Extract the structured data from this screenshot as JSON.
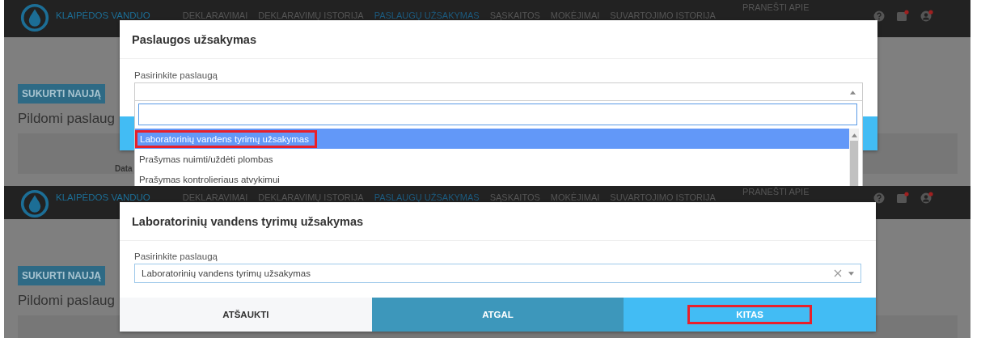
{
  "screens": [
    {
      "header": {
        "logo_text": "KLAIPĖDOS VANDUO",
        "nav": [
          {
            "label": "DEKLARAVIMAI",
            "selected": false
          },
          {
            "label": "DEKLARAVIMŲ ISTORIJA",
            "selected": false
          },
          {
            "label": "PASLAUGŲ UŽSAKYMAS",
            "selected": true
          },
          {
            "label": "SĄSKAITOS",
            "selected": false
          },
          {
            "label": "MOKĖJIMAI",
            "selected": false
          },
          {
            "label": "SUVARTOJIMO ISTORIJA",
            "selected": false
          },
          {
            "label": "PRANEŠTI APIE",
            "selected": false
          }
        ]
      },
      "page": {
        "create_button": "SUKURTI NAUJĄ",
        "heading": "Pildomi paslaug",
        "table_header": "Data"
      },
      "dialog": {
        "title": "Paslaugos užsakymas",
        "field_label": "Pasirinkite paslaugą",
        "expanded": true,
        "options": [
          {
            "label": "Laboratorinių vandens tyrimų užsakymas",
            "selected": true,
            "annotated": true
          },
          {
            "label": "Prašymas nuimti/uždėti plombas",
            "selected": false,
            "annotated": false
          },
          {
            "label": "Prašymas kontrolieriaus atvykimui",
            "selected": false,
            "annotated": false
          }
        ]
      }
    },
    {
      "header": {
        "logo_text": "KLAIPĖDOS VANDUO",
        "nav": [
          {
            "label": "DEKLARAVIMAI",
            "selected": false
          },
          {
            "label": "DEKLARAVIMŲ ISTORIJA",
            "selected": false
          },
          {
            "label": "PASLAUGŲ UŽSAKYMAS",
            "selected": true
          },
          {
            "label": "SĄSKAITOS",
            "selected": false
          },
          {
            "label": "MOKĖJIMAI",
            "selected": false
          },
          {
            "label": "SUVARTOJIMO ISTORIJA",
            "selected": false
          },
          {
            "label": "PRANEŠTI APIE",
            "selected": false
          }
        ]
      },
      "page": {
        "create_button": "SUKURTI NAUJĄ",
        "heading": "Pildomi paslaug"
      },
      "dialog": {
        "title": "Laboratorinių vandens tyrimų užsakymas",
        "field_label": "Pasirinkite paslaugą",
        "value": "Laboratorinių vandens tyrimų užsakymas",
        "expanded": false,
        "buttons": [
          {
            "label": "ATŠAUKTI",
            "kind": "cancel",
            "annotated": false
          },
          {
            "label": "ATGAL",
            "kind": "back",
            "annotated": false
          },
          {
            "label": "KITAS",
            "kind": "next",
            "annotated": true
          }
        ]
      }
    }
  ]
}
